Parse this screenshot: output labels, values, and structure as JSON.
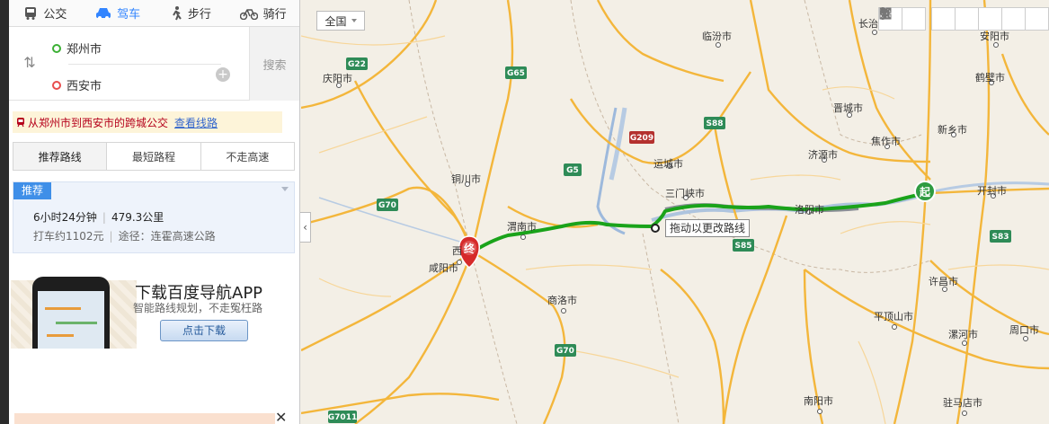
{
  "modes": [
    {
      "label": "公交",
      "icon": "bus-icon"
    },
    {
      "label": "驾车",
      "icon": "car-icon",
      "active": true
    },
    {
      "label": "步行",
      "icon": "walk-icon"
    },
    {
      "label": "骑行",
      "icon": "bike-icon"
    }
  ],
  "route": {
    "start": "郑州市",
    "end": "西安市",
    "search_label": "搜索",
    "swap_icon": "swap-icon",
    "add_icon": "add-waypoint-icon"
  },
  "notice": {
    "text": "从郑州市到西安市的跨城公交",
    "link": "查看线路",
    "icon": "train-icon"
  },
  "tabs": [
    "推荐路线",
    "最短路程",
    "不走高速"
  ],
  "plan": {
    "badge": "推荐",
    "duration": "6小时24分钟",
    "distance": "479.3公里",
    "taxi": "打车约1102元",
    "via": "途径：连霍高速公路"
  },
  "ad": {
    "title": "下载百度导航APP",
    "subtitle": "智能路线规划，不走冤枉路",
    "button": "点击下载"
  },
  "map": {
    "scope": "全国",
    "drag_tip": "拖动以更改路线",
    "start_marker": "起",
    "end_marker": "终",
    "route_color": "#1aa31a",
    "cities": [
      {
        "id": "anyang",
        "name": "安阳市"
      },
      {
        "id": "changzhi",
        "name": "长治市"
      },
      {
        "id": "linfen",
        "name": "临汾市"
      },
      {
        "id": "qingyang",
        "name": "庆阳市"
      },
      {
        "id": "hebi",
        "name": "鹤壁市"
      },
      {
        "id": "jincheng",
        "name": "晋城市"
      },
      {
        "id": "xinxiang",
        "name": "新乡市"
      },
      {
        "id": "jiaozuo",
        "name": "焦作市"
      },
      {
        "id": "jiyuan",
        "name": "济源市"
      },
      {
        "id": "yuncheng",
        "name": "运城市"
      },
      {
        "id": "tongchuan",
        "name": "铜川市"
      },
      {
        "id": "sanmenxia",
        "name": "三门峡市"
      },
      {
        "id": "kaifeng",
        "name": "开封市"
      },
      {
        "id": "luoyang",
        "name": "洛阳市"
      },
      {
        "id": "weinan",
        "name": "渭南市"
      },
      {
        "id": "xianyang",
        "name": "咸阳市"
      },
      {
        "id": "xian",
        "name": "西"
      },
      {
        "id": "shangluo",
        "name": "商洛市"
      },
      {
        "id": "xuchang",
        "name": "许昌市"
      },
      {
        "id": "pingdingshan",
        "name": "平顶山市"
      },
      {
        "id": "luohe",
        "name": "漯河市"
      },
      {
        "id": "zhoukou",
        "name": "周口市"
      },
      {
        "id": "nanyang",
        "name": "南阳市"
      },
      {
        "id": "zhumadian",
        "name": "驻马店市"
      }
    ],
    "shields": [
      "G22",
      "G65",
      "S88",
      "G209",
      "G5",
      "G70",
      "S85",
      "S83",
      "G70",
      "G7011"
    ]
  }
}
